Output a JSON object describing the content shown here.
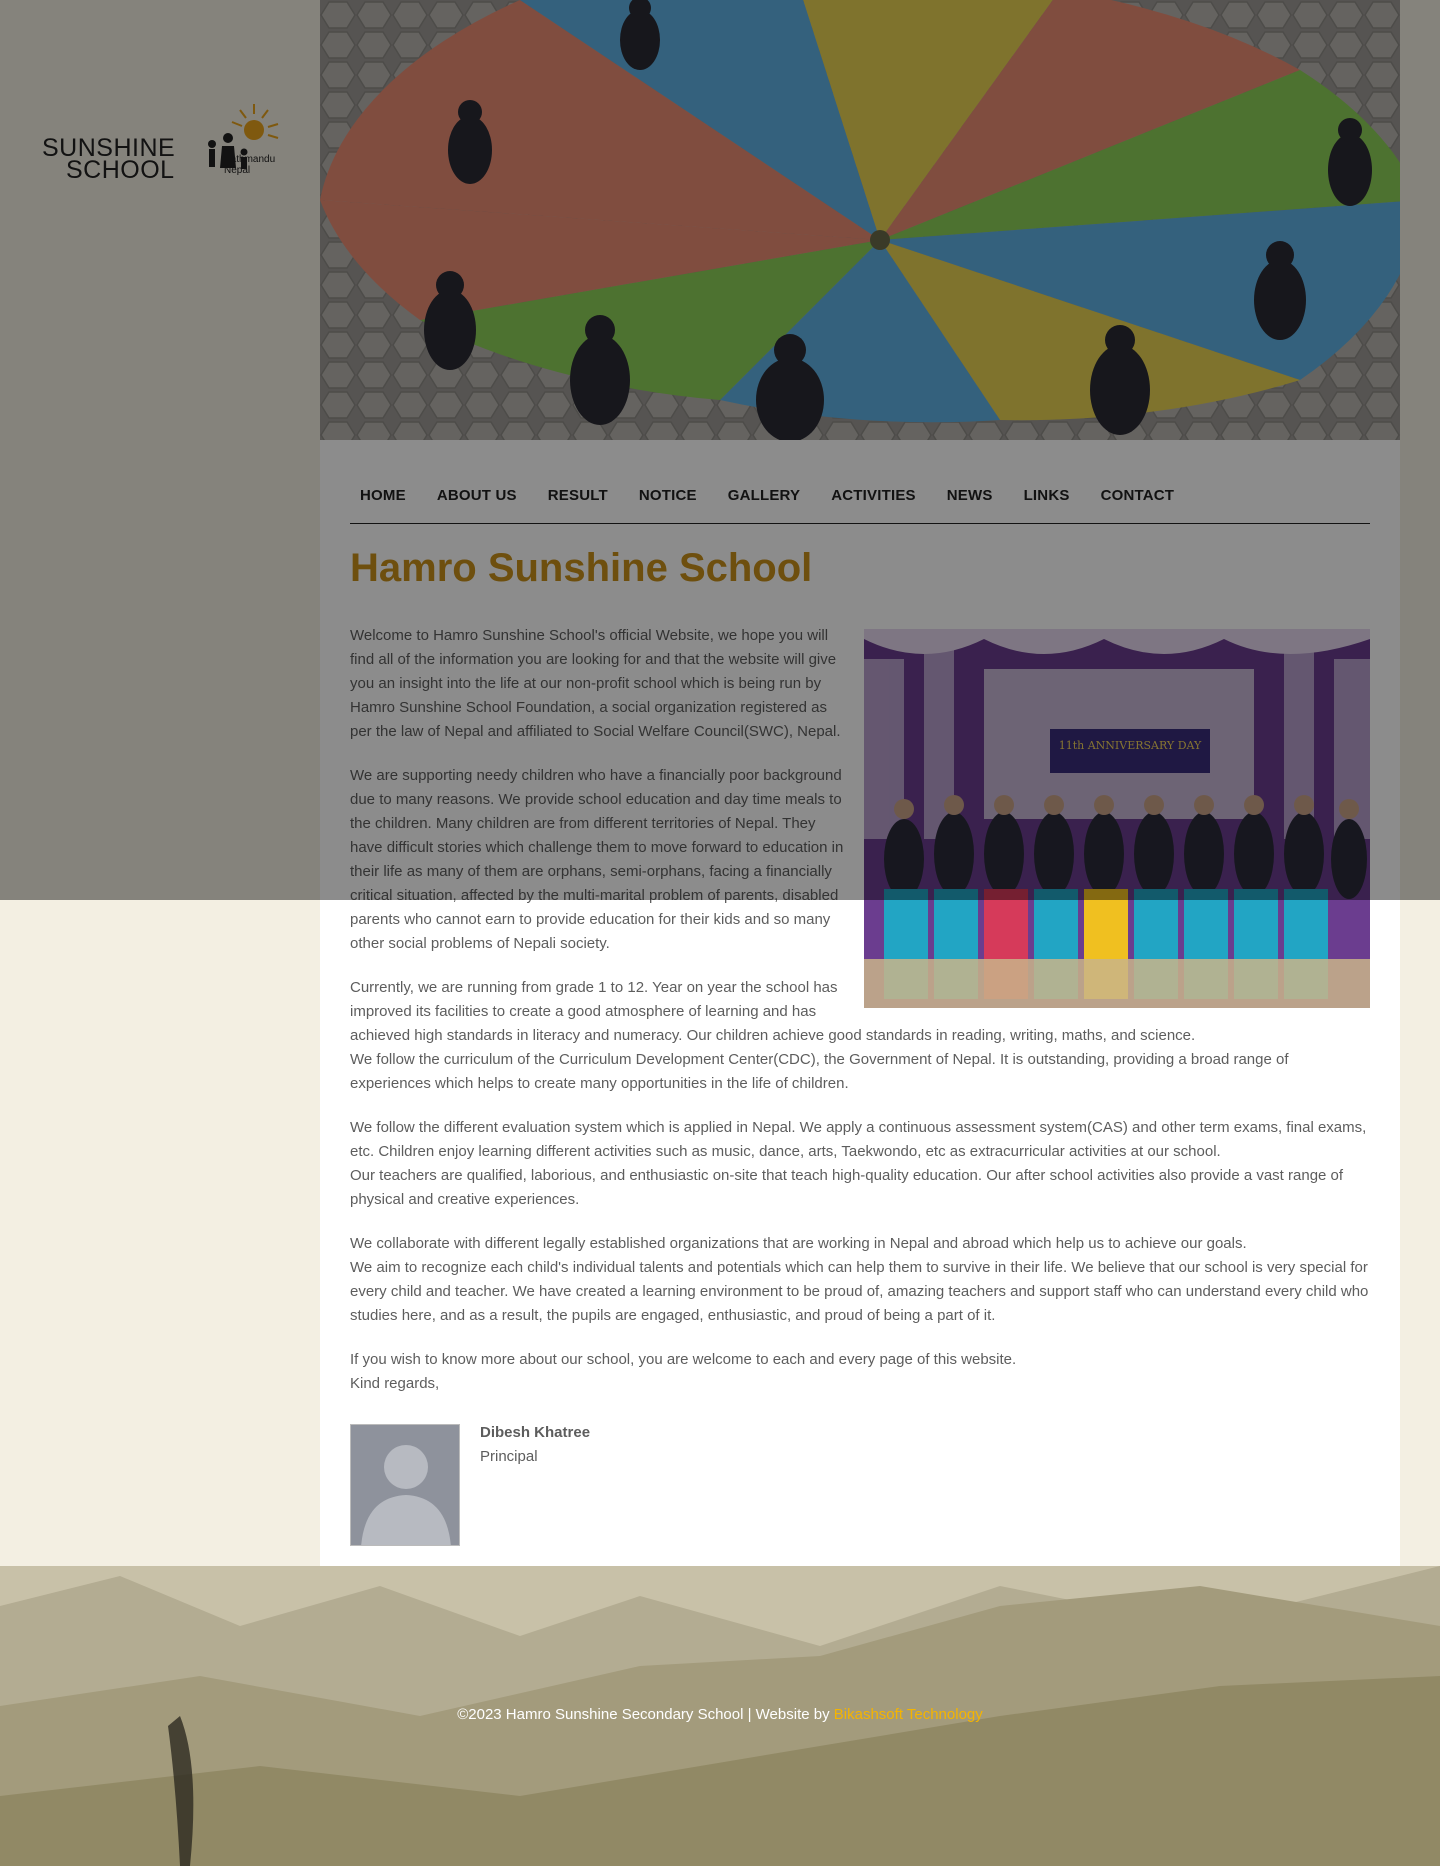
{
  "logo": {
    "line1": "SUNSHINE",
    "line2": "SCHOOL",
    "location_line1": "Kathmandu",
    "location_line2": "Nepal"
  },
  "nav": {
    "items": [
      "HOME",
      "ABOUT US",
      "RESULT",
      "NOTICE",
      "GALLERY",
      "ACTIVITIES",
      "NEWS",
      "LINKS",
      "CONTACT"
    ]
  },
  "page": {
    "title": "Hamro Sunshine School",
    "paragraphs": [
      "Welcome to Hamro Sunshine School's official Website, we hope you will find all of the information you are looking for and that the website will give you an insight into the life at our non-profit school which is being run by Hamro Sunshine School Foundation, a social organization registered as per the law of Nepal and affiliated to Social Welfare Council(SWC), Nepal.",
      "We are supporting needy children who have a financially poor background due to many reasons. We provide school education and day time meals to the children. Many children are from different territories of Nepal. They have difficult stories which challenge them to move forward to education in",
      "their life as many of them are orphans, semi-orphans, facing a financially critical situation, affected by the multi-marital problem of parents, disabled parents who cannot earn to provide education for their kids and so many other social problems of Nepali society.",
      "Currently, we are running from grade 1 to 12. Year on year the school has improved its facilities to create a good atmosphere of learning and has",
      "achieved high standards in literacy and numeracy. Our children achieve good standards in reading, writing, maths, and science.",
      "We follow the curriculum of the Curriculum Development Center(CDC), the Government of Nepal. It is outstanding, providing a broad range of experiences which helps to create many opportunities in the life of children.",
      "We follow the different evaluation system which is applied in Nepal. We apply a continuous assessment system(CAS) and other term exams, final exams, etc. Children enjoy learning different activities such as music, dance, arts, Taekwondo, etc as extracurricular activities at our school.",
      "Our teachers are qualified, laborious, and enthusiastic on-site that teach high-quality education. Our after school activities also provide a vast range of physical and creative experiences.",
      "We collaborate with different legally established organizations that are working in Nepal and abroad which help us to achieve our goals.",
      "We aim to recognize each child's individual talents and potentials which can help them to survive in their life. We believe that our school is very special for every child and teacher. We have created a learning environment to be proud of, amazing teachers and support staff who can understand every child who studies here, and as a result, the pupils are engaged, enthusiastic, and proud of being a part of it.",
      "If you wish to know more about our school, you are welcome to each and every page of this website.",
      "Kind regards,"
    ],
    "photo_banner": "11th ANNIVERSARY DAY"
  },
  "signature": {
    "name": "Dibesh Khatree",
    "role": "Principal"
  },
  "footer": {
    "copyright": "©2023 Hamro Sunshine Secondary School | Website by",
    "credit_link": "Bikashsoft Technology"
  },
  "colors": {
    "title_gold": "#c8901a",
    "link_gold": "#f5b400",
    "sidebar_bg": "#f3efe2"
  }
}
